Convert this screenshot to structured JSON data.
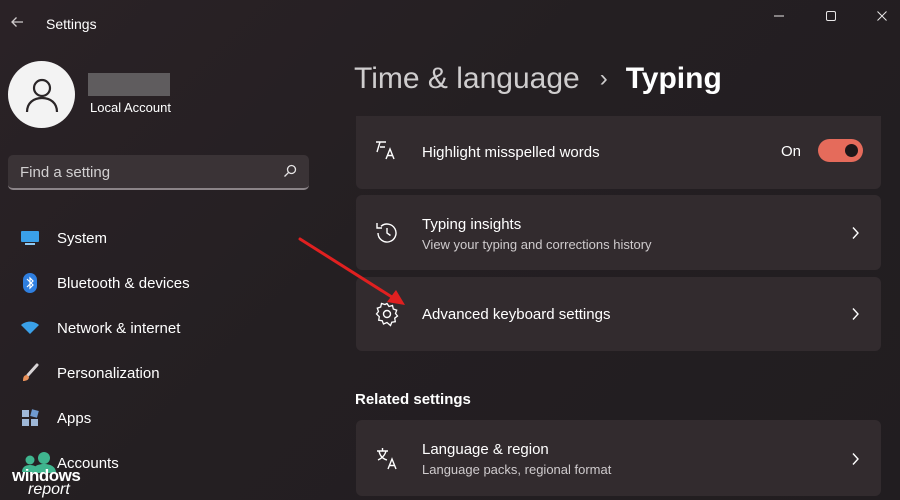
{
  "window": {
    "title": "Settings",
    "controls": {
      "minimize": "minimize-icon",
      "maximize": "maximize-icon",
      "close": "close-icon"
    }
  },
  "user": {
    "account_type": "Local Account"
  },
  "search": {
    "placeholder": "Find a setting"
  },
  "sidebar": {
    "items": [
      {
        "label": "System",
        "icon": "display-icon"
      },
      {
        "label": "Bluetooth & devices",
        "icon": "bluetooth-icon"
      },
      {
        "label": "Network & internet",
        "icon": "wifi-icon"
      },
      {
        "label": "Personalization",
        "icon": "brush-icon"
      },
      {
        "label": "Apps",
        "icon": "apps-icon"
      },
      {
        "label": "Accounts",
        "icon": "person-icon"
      }
    ]
  },
  "breadcrumb": {
    "parent": "Time & language",
    "separator": "›",
    "current": "Typing"
  },
  "settings": {
    "highlight": {
      "title": "Highlight misspelled words",
      "state": "On"
    },
    "insights": {
      "title": "Typing insights",
      "subtitle": "View your typing and corrections history"
    },
    "advanced": {
      "title": "Advanced keyboard settings"
    }
  },
  "related": {
    "header": "Related settings",
    "language": {
      "title": "Language & region",
      "subtitle": "Language packs, regional format"
    }
  },
  "watermark": {
    "line1": "windows",
    "line2": "report"
  },
  "colors": {
    "accent": "#e56b5b",
    "card_bg": "#322b2e",
    "window_bg": "#241f22",
    "annotation_arrow": "#e02020"
  }
}
